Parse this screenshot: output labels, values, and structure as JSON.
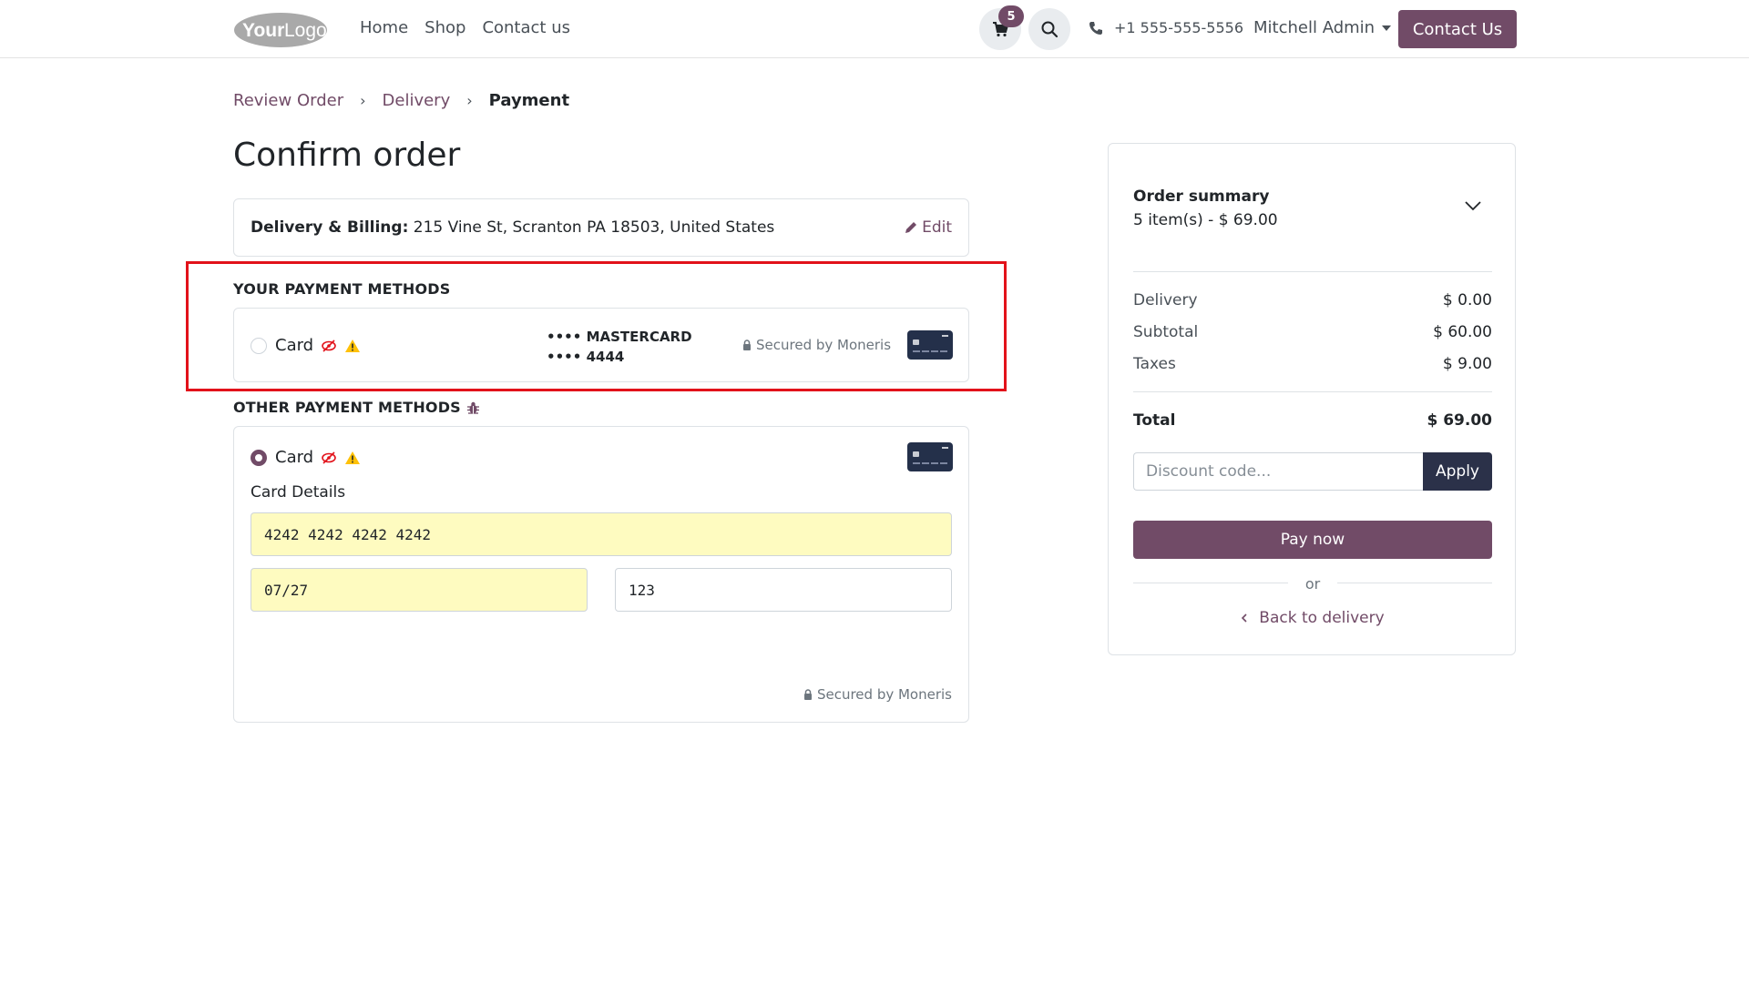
{
  "header": {
    "logo_text": "YourLogo",
    "nav": [
      "Home",
      "Shop",
      "Contact us"
    ],
    "cart_count": "5",
    "phone": "+1 555-555-5556",
    "user": "Mitchell Admin",
    "contact_button": "Contact Us"
  },
  "breadcrumb": {
    "step1": "Review Order",
    "step2": "Delivery",
    "step3": "Payment"
  },
  "page_title": "Confirm order",
  "address": {
    "label": "Delivery & Billing:",
    "value": "215 Vine St, Scranton PA 18503, United States",
    "edit": "Edit"
  },
  "saved_methods": {
    "title": "YOUR PAYMENT METHODS",
    "method_label": "Card",
    "token_line1": "•••• MASTERCARD",
    "token_line2": "•••• 4444",
    "secured": "Secured by Moneris"
  },
  "other_methods": {
    "title": "OTHER PAYMENT METHODS",
    "method_label": "Card",
    "card_details_label": "Card Details",
    "card_number": "4242 4242 4242 4242",
    "expiry": "07/27",
    "cvc": "123",
    "secured": "Secured by Moneris"
  },
  "summary": {
    "title": "Order summary",
    "subtitle": "5 item(s) -  $ 69.00",
    "delivery_label": "Delivery",
    "delivery_value": "$ 0.00",
    "subtotal_label": "Subtotal",
    "subtotal_value": "$ 60.00",
    "taxes_label": "Taxes",
    "taxes_value": "$ 9.00",
    "total_label": "Total",
    "total_value": "$ 69.00",
    "discount_placeholder": "Discount code...",
    "apply": "Apply",
    "pay_now": "Pay now",
    "or": "or",
    "back": "Back to delivery"
  },
  "colors": {
    "brand": "#714b67",
    "highlight": "#e2121a",
    "autofill": "#fefbc0",
    "apply_button": "#2b3149"
  }
}
